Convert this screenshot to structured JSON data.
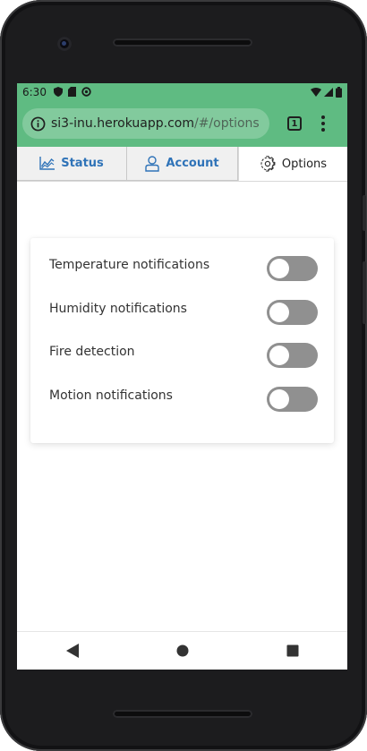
{
  "status_bar": {
    "time": "6:30",
    "icons": [
      "shield-icon",
      "sim-card-icon",
      "sync-icon",
      "wifi-icon",
      "signal-icon",
      "battery-icon"
    ]
  },
  "browser": {
    "url_host": "si3-inu.herokuapp.com",
    "url_path": "/#/options",
    "tab_count": "1",
    "toolbar_color": "#5fbb82"
  },
  "tabs": [
    {
      "label": "Status",
      "icon": "chart-icon",
      "active": false
    },
    {
      "label": "Account",
      "icon": "user-icon",
      "active": false
    },
    {
      "label": "Options",
      "icon": "gear-icon",
      "active": true
    }
  ],
  "settings": [
    {
      "label": "Temperature notifications",
      "enabled": false
    },
    {
      "label": "Humidity notifications",
      "enabled": false
    },
    {
      "label": "Fire detection",
      "enabled": false
    },
    {
      "label": "Motion notifications",
      "enabled": false
    }
  ],
  "colors": {
    "accent_link": "#2f73b8",
    "toggle_off": "#909090"
  },
  "nav_buttons": [
    "back-icon",
    "home-icon",
    "recents-icon"
  ]
}
